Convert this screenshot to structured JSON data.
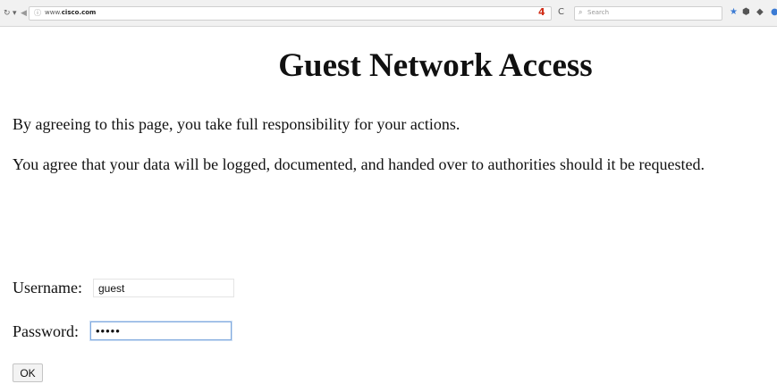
{
  "browser": {
    "back_icon": "↻",
    "nav_dropdown": "▾",
    "forward_icon": "◀",
    "url_prefix": "www.",
    "url_domain": "cisco.com",
    "security_alert": "4",
    "reload_icon": "C",
    "search_placeholder": "Search",
    "bookmark_icon": "★",
    "lock_icon": "⬢",
    "pocket_icon": "◆"
  },
  "page": {
    "title": "Guest Network Access",
    "paragraph_1": "By agreeing to this page, you take full responsibility for your actions.",
    "paragraph_2": "You agree that your data will be logged, documented, and handed over to authorities should it be requested."
  },
  "login": {
    "username_label": "Username:",
    "username_value": "guest",
    "password_label": "Password:",
    "password_value": "•••••",
    "ok_label": "OK"
  },
  "colors": {
    "alert": "#d12e19",
    "bookmark": "#3b7bd4",
    "focus_border": "#7fa9de"
  }
}
